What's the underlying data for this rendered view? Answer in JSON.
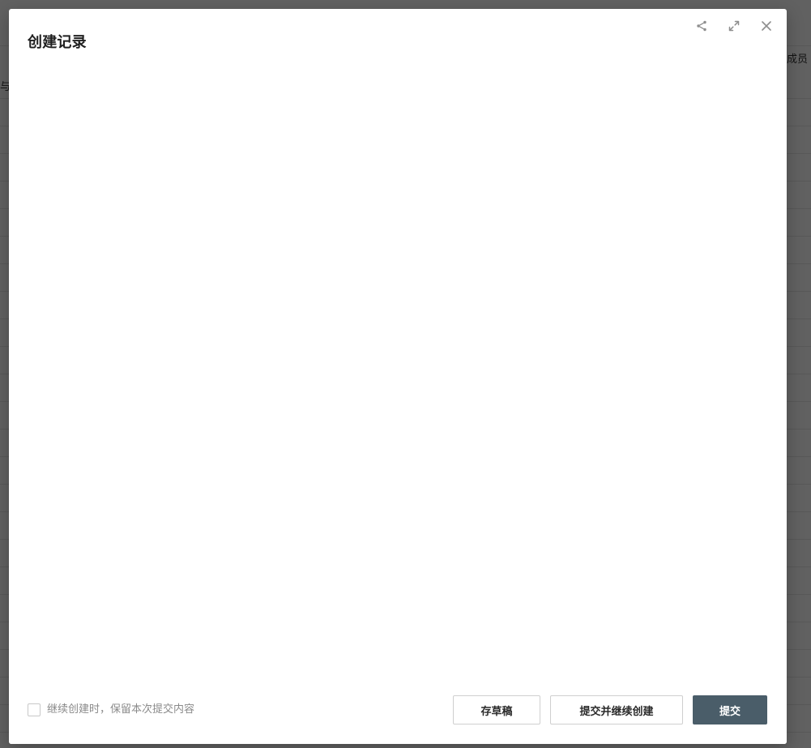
{
  "background": {
    "header_right": "成员",
    "left_row_glyph": "与"
  },
  "modal": {
    "title": "创建记录",
    "header_actions": {
      "share_icon": "share-icon",
      "expand_icon": "expand-icon",
      "close_icon": "close-icon"
    },
    "footer": {
      "keep_content_label": "继续创建时，保留本次提交内容",
      "save_draft_label": "存草稿",
      "submit_continue_label": "提交并继续创建",
      "submit_label": "提交"
    }
  },
  "colors": {
    "overlay": "#1f1f1f",
    "primary_button": "#4a5d69",
    "title_text": "#1f1f1f",
    "muted_text": "#8a8a8a"
  }
}
